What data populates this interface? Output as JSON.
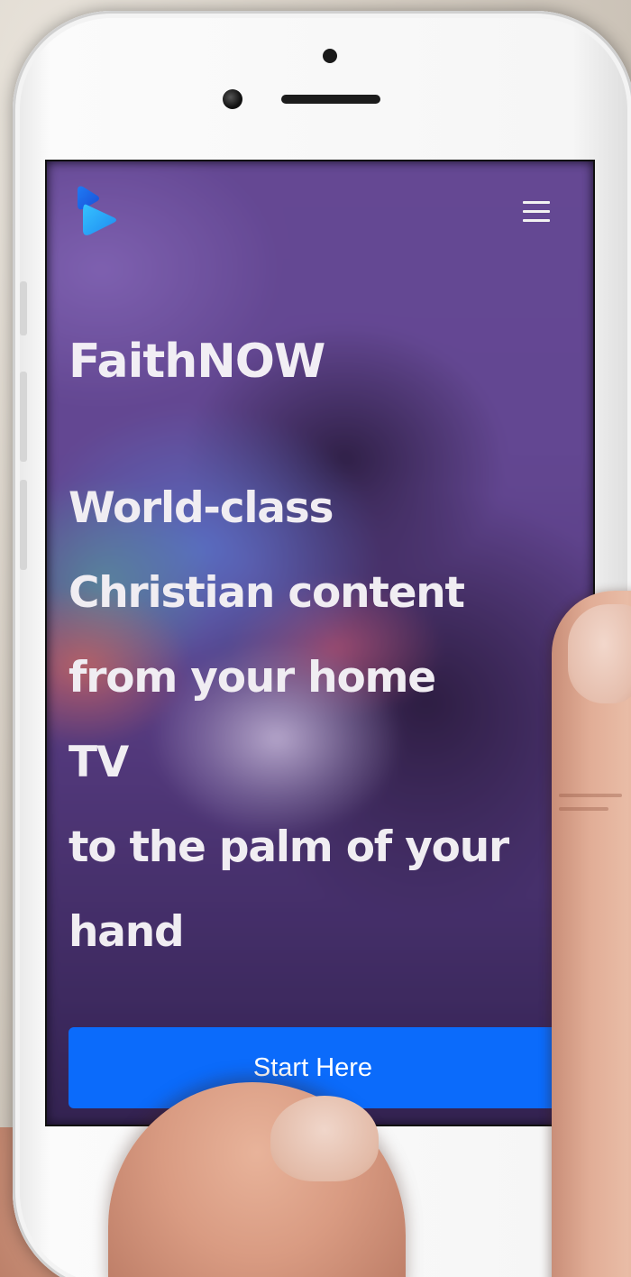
{
  "header": {
    "logo_icon": "play-arrow-logo",
    "menu_icon": "hamburger-menu-icon"
  },
  "hero": {
    "brand": "FaithNOW",
    "headline_lines": [
      "World-class",
      "Christian content",
      "from your home",
      "TV",
      "to the palm of your",
      "hand"
    ],
    "cta_label": "Start Here"
  },
  "colors": {
    "accent": "#0b6bfb",
    "hero_overlay": "#6a4e97",
    "text": "#f1eef4"
  }
}
